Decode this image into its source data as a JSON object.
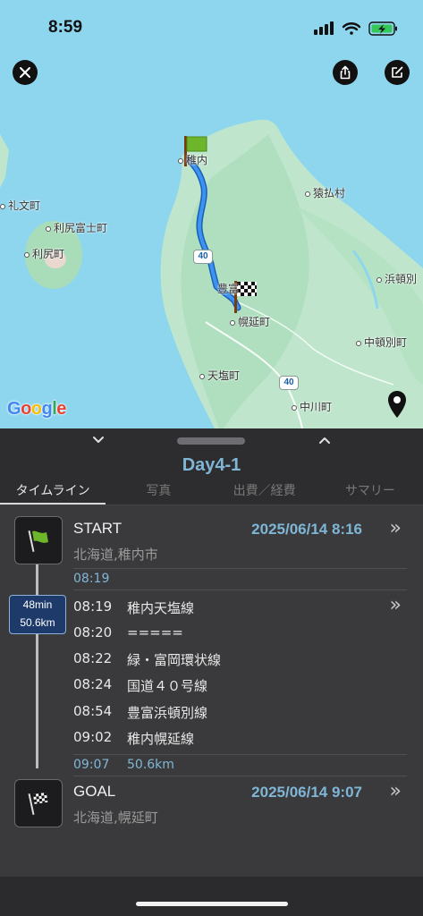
{
  "status": {
    "time": "8:59"
  },
  "map": {
    "labels": {
      "wakkanai": "稚内",
      "sarufutsu": "猿払村",
      "rebun": "礼文町",
      "rishirifuji": "利尻富士町",
      "rishiri": "利尻町",
      "toyotomi": "豊富",
      "horonobe": "幌延町",
      "hamatonbetsu": "浜頓別",
      "nakatonbetsu": "中頓別町",
      "teshio": "天塩町",
      "nakagawa": "中川町"
    },
    "route_badges": [
      "40",
      "40"
    ],
    "google": [
      "G",
      "o",
      "o",
      "g",
      "l",
      "e"
    ],
    "colors": {
      "water": "#8ed6ee",
      "land": "#bfe6cc",
      "route": "#2e7de0"
    }
  },
  "panel": {
    "title": "Day4-1",
    "tabs": [
      "タイムライン",
      "写真",
      "出費／経費",
      "サマリー"
    ],
    "start": {
      "label": "START",
      "datetime": "2025/06/14 8:16",
      "place": "北海道,稚内市",
      "depart": "08:19"
    },
    "duration": {
      "time": "48min",
      "distance": "50.6km"
    },
    "segments": [
      {
        "time": "08:19",
        "name": "稚内天塩線"
      },
      {
        "time": "08:20",
        "name": "====="
      },
      {
        "time": "08:22",
        "name": "緑・富岡環状線"
      },
      {
        "time": "08:24",
        "name": "国道４０号線"
      },
      {
        "time": "08:54",
        "name": "豊富浜頓別線"
      },
      {
        "time": "09:02",
        "name": "稚内幌延線"
      }
    ],
    "arrival": {
      "time": "09:07",
      "distance": "50.6km"
    },
    "goal": {
      "label": "GOAL",
      "datetime": "2025/06/14 9:07",
      "place": "北海道,幌延町"
    }
  }
}
